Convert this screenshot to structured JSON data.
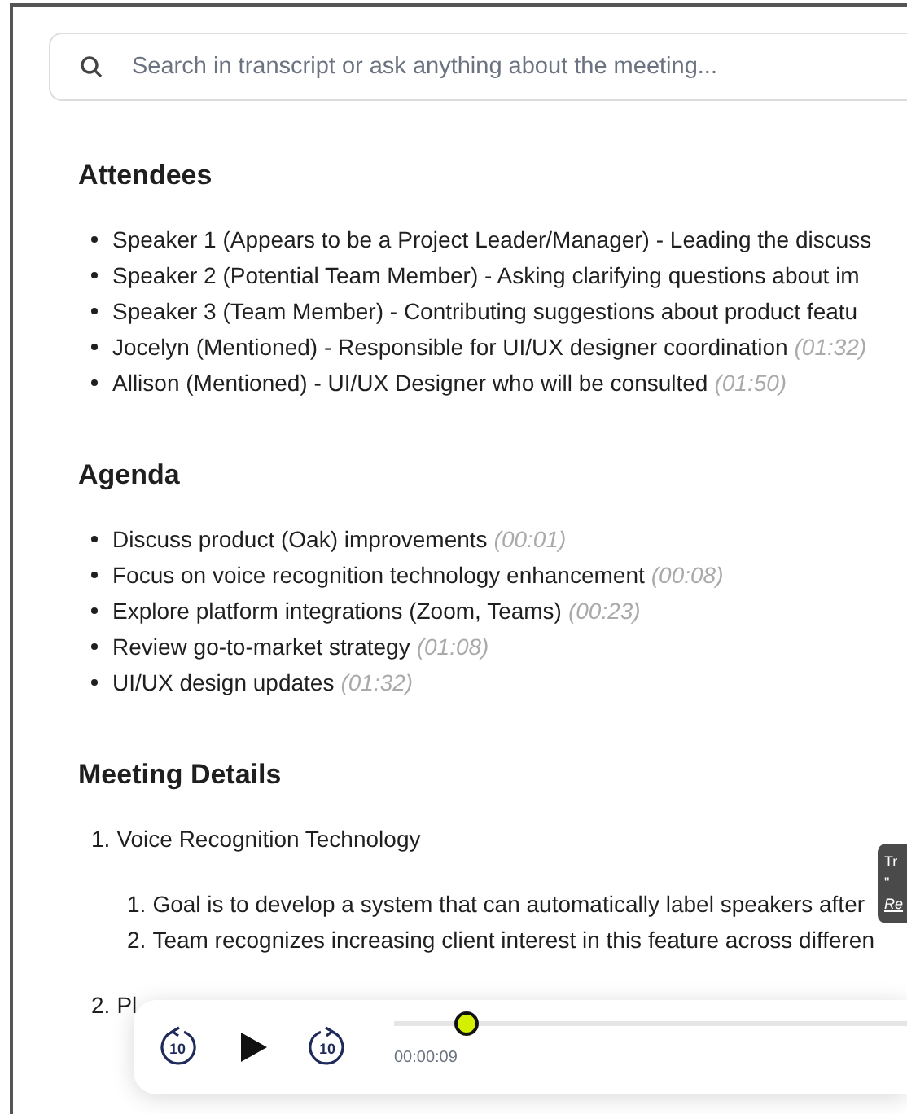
{
  "search": {
    "placeholder": "Search in transcript or ask anything about the meeting..."
  },
  "sections": [
    {
      "title": "Attendees",
      "kind": "bullets",
      "items": [
        {
          "text": "Speaker 1 (Appears to be a Project Leader/Manager) - Leading the discuss"
        },
        {
          "text": "Speaker 2 (Potential Team Member) - Asking clarifying questions about im"
        },
        {
          "text": "Speaker 3 (Team Member) - Contributing suggestions about product featu"
        },
        {
          "text": "Jocelyn (Mentioned) - Responsible for UI/UX designer coordination",
          "time": "(01:32)"
        },
        {
          "text": "Allison (Mentioned) - UI/UX Designer who will be consulted",
          "time": "(01:50)"
        }
      ]
    },
    {
      "title": "Agenda",
      "kind": "bullets",
      "items": [
        {
          "text": "Discuss product (Oak) improvements",
          "time": "(00:01)"
        },
        {
          "text": "Focus on voice recognition technology enhancement",
          "time": "(00:08)"
        },
        {
          "text": "Explore platform integrations (Zoom, Teams)",
          "time": "(00:23)"
        },
        {
          "text": "Review go-to-market strategy",
          "time": "(01:08)"
        },
        {
          "text": "UI/UX design updates",
          "time": "(01:32)"
        }
      ]
    },
    {
      "title": "Meeting Details",
      "kind": "numbered",
      "items": [
        {
          "number": "1.",
          "text": "Voice Recognition Technology",
          "children": [
            {
              "number": "1.",
              "text": "Goal is to develop a system that can automatically label speakers after"
            },
            {
              "number": "2.",
              "text": "Team recognizes increasing client interest in this feature across differen"
            }
          ]
        },
        {
          "number": "2.",
          "text": "Pl"
        }
      ]
    }
  ],
  "tooltip": {
    "lines": [
      {
        "text": "Tr",
        "link": false
      },
      {
        "text": "\"",
        "link": false
      },
      {
        "text": "Re",
        "link": true
      }
    ]
  },
  "player": {
    "rewind_label": "10",
    "forward_label": "10",
    "level": 0.14,
    "time": "00:00:09"
  }
}
